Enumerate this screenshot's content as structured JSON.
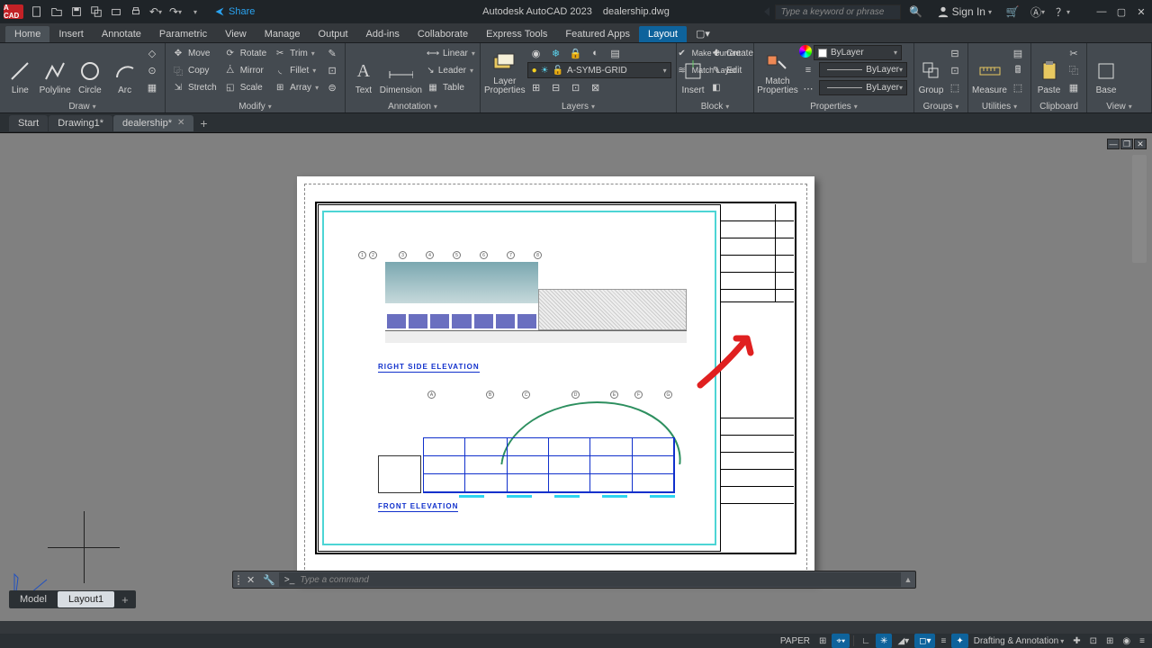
{
  "titlebar": {
    "app_badge": "A CAD",
    "app_name": "Autodesk AutoCAD 2023",
    "doc_name": "dealership.dwg",
    "share": "Share",
    "search_placeholder": "Type a keyword or phrase",
    "signin": "Sign In"
  },
  "menus": [
    "Home",
    "Insert",
    "Annotate",
    "Parametric",
    "View",
    "Manage",
    "Output",
    "Add-ins",
    "Collaborate",
    "Express Tools",
    "Featured Apps",
    "Layout"
  ],
  "ribbon": {
    "draw": {
      "title": "Draw",
      "line": "Line",
      "polyline": "Polyline",
      "circle": "Circle",
      "arc": "Arc"
    },
    "modify": {
      "title": "Modify",
      "move": "Move",
      "copy": "Copy",
      "stretch": "Stretch",
      "rotate": "Rotate",
      "mirror": "Mirror",
      "scale": "Scale",
      "trim": "Trim",
      "fillet": "Fillet",
      "array": "Array"
    },
    "annotation": {
      "title": "Annotation",
      "text": "Text",
      "dimension": "Dimension",
      "linear": "Linear",
      "leader": "Leader",
      "table": "Table"
    },
    "layers": {
      "title": "Layers",
      "props": "Layer\nProperties",
      "current_layer": "A-SYMB-GRID",
      "make_current": "Make Current",
      "match": "Match Layer"
    },
    "block": {
      "title": "Block",
      "insert": "Insert",
      "create": "Create",
      "edit": "Edit"
    },
    "properties": {
      "title": "Properties",
      "match": "Match\nProperties",
      "bylayer": "ByLayer"
    },
    "groups": {
      "title": "Groups",
      "group": "Group"
    },
    "utilities": {
      "title": "Utilities",
      "measure": "Measure"
    },
    "clipboard": {
      "title": "Clipboard",
      "paste": "Paste"
    },
    "view": {
      "title": "View",
      "base": "Base"
    }
  },
  "filetabs": {
    "start": "Start",
    "drawing1": "Drawing1*",
    "dealership": "dealership*"
  },
  "drawing": {
    "right_elev": "RIGHT SIDE ELEVATION",
    "front_elev": "FRONT ELEVATION"
  },
  "cmd": {
    "prompt": ">_",
    "placeholder": "Type a command"
  },
  "layout_tabs": {
    "model": "Model",
    "layout1": "Layout1"
  },
  "status": {
    "paper": "PAPER",
    "workspace": "Drafting & Annotation"
  }
}
